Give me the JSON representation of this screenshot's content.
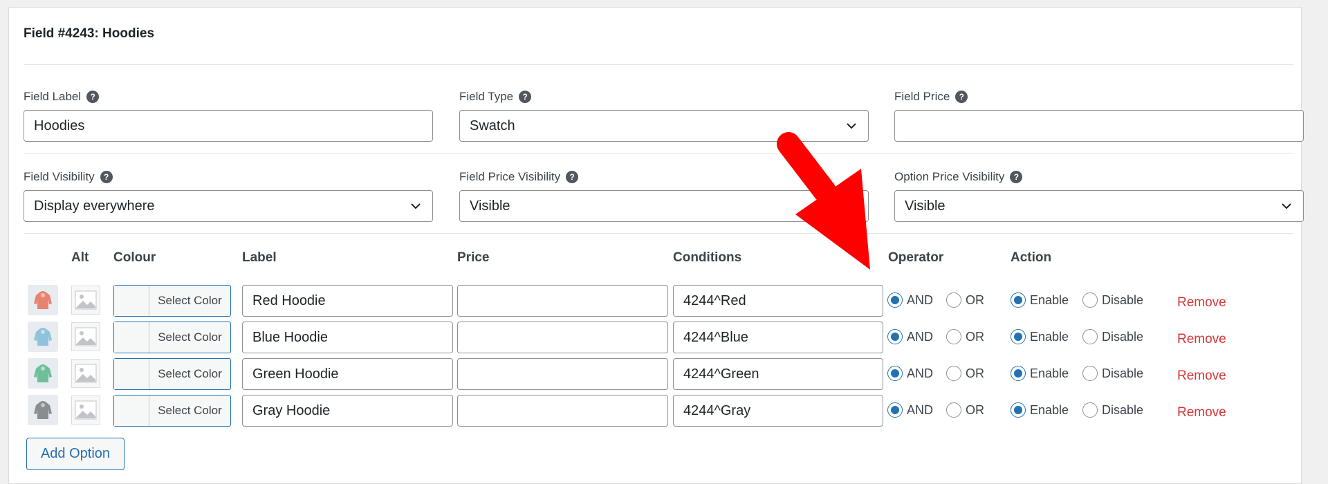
{
  "field_title": "Field #4243: Hoodies",
  "fields_row1": [
    {
      "label": "Field Label",
      "value": "Hoodies",
      "type": "text"
    },
    {
      "label": "Field Type",
      "value": "Swatch",
      "type": "select"
    },
    {
      "label": "Field Price",
      "value": "",
      "type": "text"
    }
  ],
  "fields_row2": [
    {
      "label": "Field Visibility",
      "value": "Display everywhere",
      "type": "select"
    },
    {
      "label": "Field Price Visibility",
      "value": "Visible",
      "type": "select"
    },
    {
      "label": "Option Price Visibility",
      "value": "Visible",
      "type": "select"
    }
  ],
  "help_glyph": "?",
  "table": {
    "headers": {
      "alt": "Alt",
      "colour": "Colour",
      "label": "Label",
      "price": "Price",
      "conditions": "Conditions",
      "operator": "Operator",
      "action": "Action"
    },
    "rows": [
      {
        "thumb_color": "#e8836f",
        "colour_button": "Select Color",
        "label": "Red Hoodie",
        "price": "",
        "conditions": "4244^Red",
        "op_and": "AND",
        "op_or": "OR",
        "operator": "AND",
        "act_enable": "Enable",
        "act_disable": "Disable",
        "action": "Enable",
        "remove": "Remove"
      },
      {
        "thumb_color": "#8fc3dd",
        "colour_button": "Select Color",
        "label": "Blue Hoodie",
        "price": "",
        "conditions": "4244^Blue",
        "op_and": "AND",
        "op_or": "OR",
        "operator": "AND",
        "act_enable": "Enable",
        "act_disable": "Disable",
        "action": "Enable",
        "remove": "Remove"
      },
      {
        "thumb_color": "#6fbf9a",
        "colour_button": "Select Color",
        "label": "Green Hoodie",
        "price": "",
        "conditions": "4244^Green",
        "op_and": "AND",
        "op_or": "OR",
        "operator": "AND",
        "act_enable": "Enable",
        "act_disable": "Disable",
        "action": "Enable",
        "remove": "Remove"
      },
      {
        "thumb_color": "#8a8d90",
        "colour_button": "Select Color",
        "label": "Gray Hoodie",
        "price": "",
        "conditions": "4244^Gray",
        "op_and": "AND",
        "op_or": "OR",
        "operator": "AND",
        "act_enable": "Enable",
        "act_disable": "Disable",
        "action": "Enable",
        "remove": "Remove"
      }
    ]
  },
  "add_option": "Add Option",
  "colors": {
    "accent": "#2271b1",
    "remove": "#d63638",
    "annotation_arrow": "#ff0000"
  }
}
